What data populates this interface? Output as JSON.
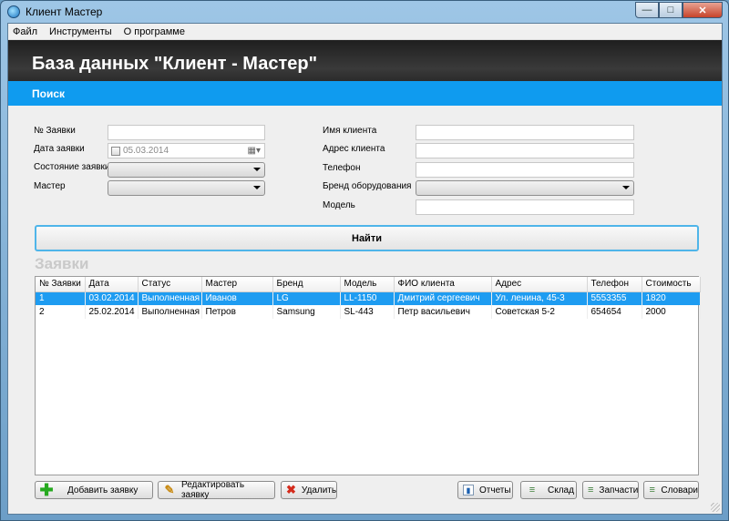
{
  "window": {
    "title": "Клиент Мастер",
    "minimize": "—",
    "maximize": "□",
    "close": "✕"
  },
  "menu": {
    "items": [
      "Файл",
      "Инструменты",
      "О программе"
    ]
  },
  "header": {
    "title": "База данных \"Клиент - Мастер\""
  },
  "search": {
    "title": "Поиск",
    "left_labels": [
      "№ Заявки",
      "Дата заявки",
      "Состояние заявки",
      "Мастер"
    ],
    "right_labels": [
      "Имя клиента",
      "Адрес клиента",
      "Телефон",
      "Бренд оборудования",
      "Модель"
    ],
    "date_value": "05.03.2014",
    "find_button": "Найти"
  },
  "orders": {
    "title": "Заявки",
    "columns": [
      "№ Заявки",
      "Дата",
      "Статус",
      "Мастер",
      "Бренд",
      "Модель",
      "ФИО клиента",
      "Адрес",
      "Телефон",
      "Стоимость"
    ],
    "rows": [
      [
        "1",
        "03.02.2014",
        "Выполненная",
        "Иванов",
        "LG",
        "LL-1150",
        "Дмитрий сергеевич",
        "Ул. ленина, 45-3",
        "5553355",
        "1820"
      ],
      [
        "2",
        "25.02.2014",
        "Выполненная",
        "Петров",
        "Samsung",
        "SL-443",
        "Петр васильевич",
        "Советская 5-2",
        "654654",
        "2000"
      ]
    ],
    "selected_row": 0
  },
  "actions": {
    "add": "Добавить заявку",
    "edit": "Редактировать заявку",
    "delete": "Удалить",
    "reports": "Отчеты",
    "warehouse": "Склад",
    "parts": "Запчасти",
    "dictionaries": "Словари"
  },
  "colors": {
    "accent": "#0f9bef",
    "header_bg": "#2b2b2b",
    "selected_row": "#1e9cf1"
  }
}
